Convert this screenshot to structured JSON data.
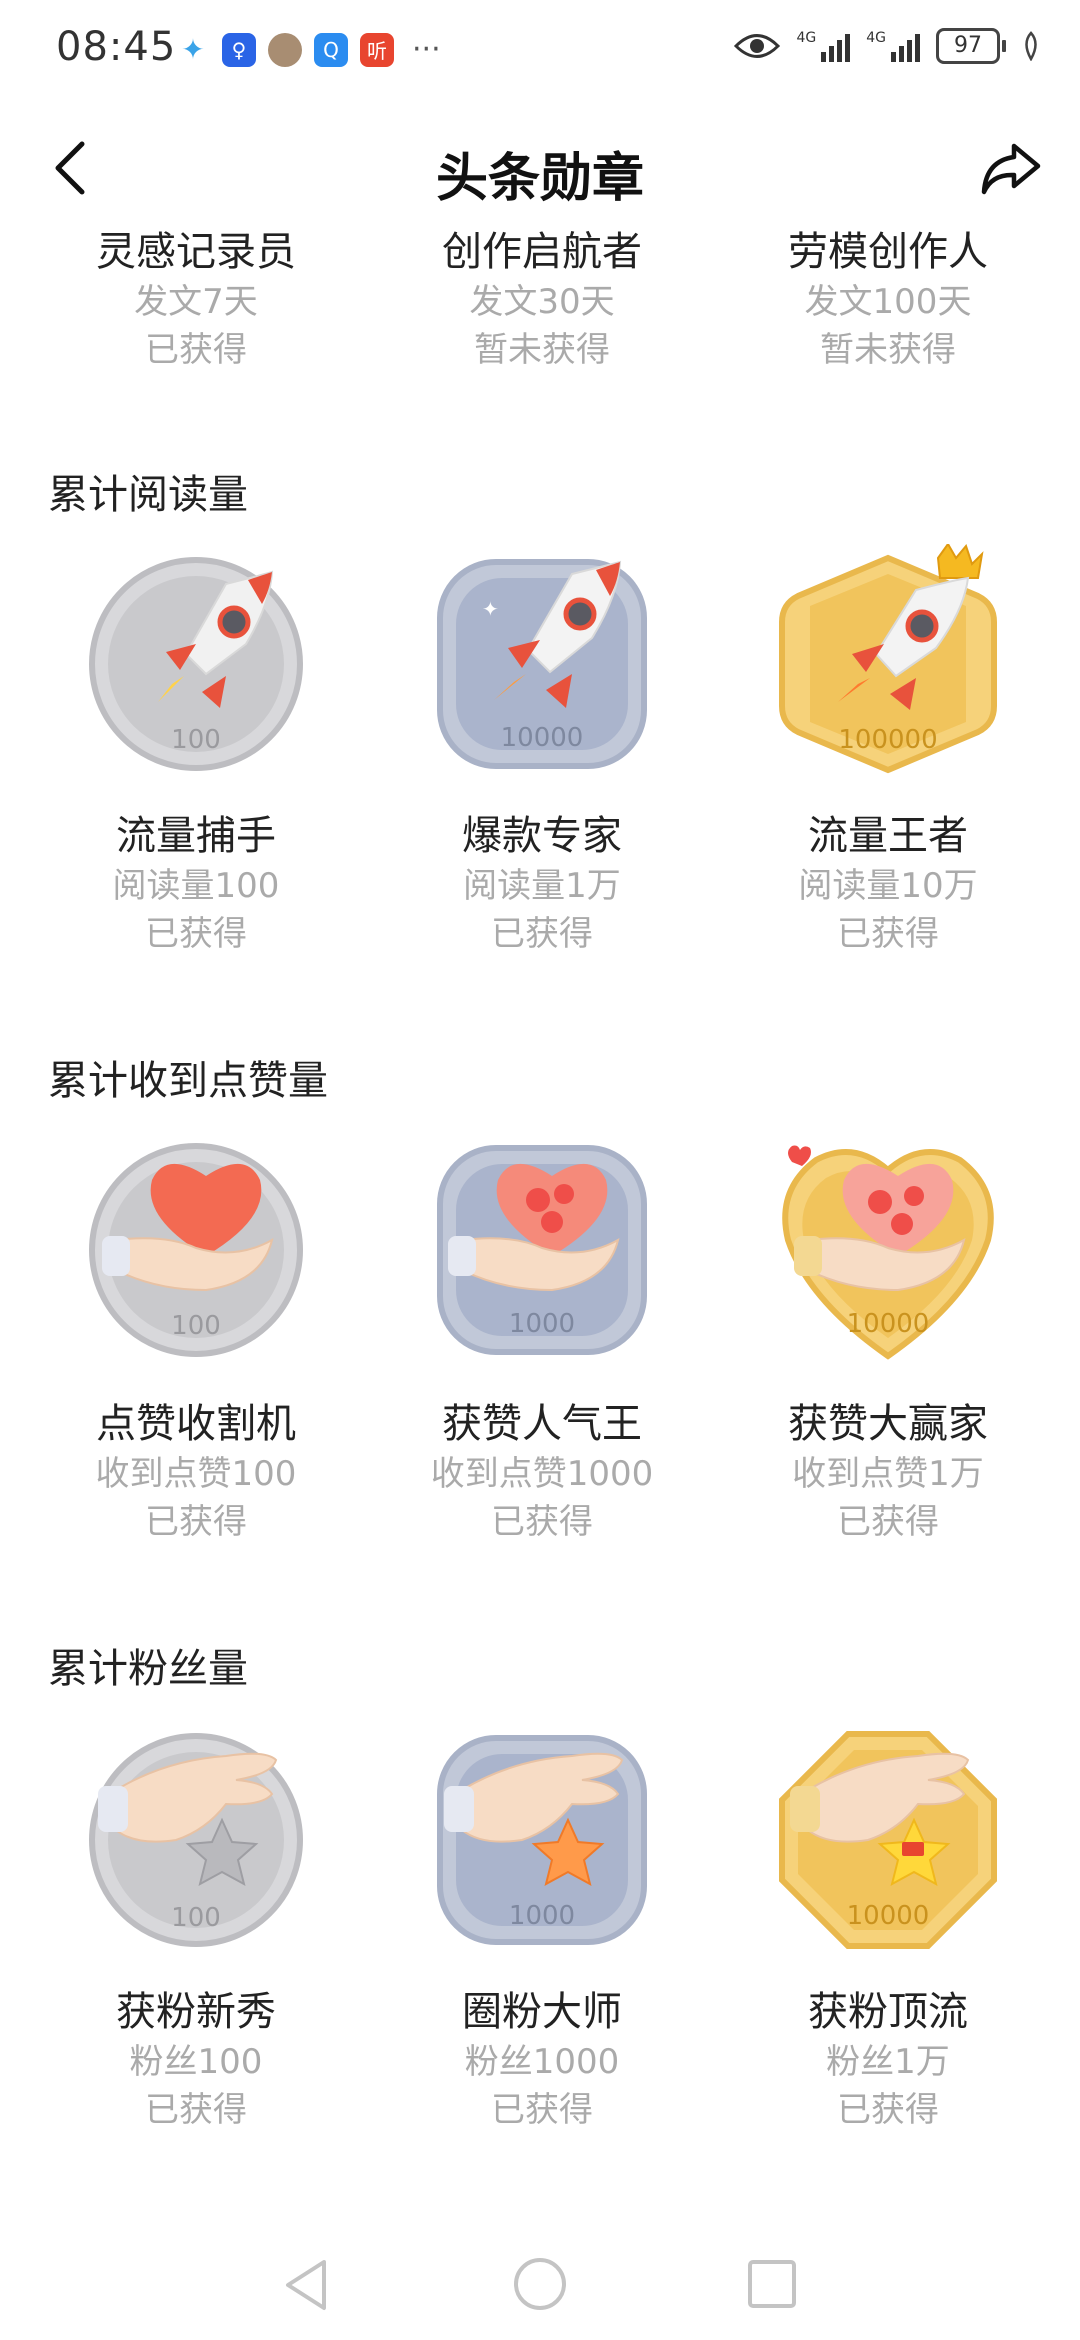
{
  "status_bar": {
    "time": "08:45",
    "notification_icons": [
      "compass-icon",
      "bulb-icon",
      "avatar-icon",
      "search-app-icon",
      "listen-app-icon"
    ],
    "notification_label": "听",
    "signal_label_1": "4G",
    "signal_label_2": "4G",
    "battery": "97"
  },
  "header": {
    "title": "头条勋章"
  },
  "partial_row": [
    {
      "name": "灵感记录员",
      "req": "发文7天",
      "status": "已获得"
    },
    {
      "name": "创作启航者",
      "req": "发文30天",
      "status": "暂未获得"
    },
    {
      "name": "劳模创作人",
      "req": "发文100天",
      "status": "暂未获得"
    }
  ],
  "sections": [
    {
      "title": "累计阅读量",
      "badges": [
        {
          "name": "流量捕手",
          "req": "阅读量100",
          "status": "已获得",
          "icon_number": "100",
          "tier": "silver",
          "icon": "rocket-icon"
        },
        {
          "name": "爆款专家",
          "req": "阅读量1万",
          "status": "已获得",
          "icon_number": "10000",
          "tier": "blue",
          "icon": "rocket-icon"
        },
        {
          "name": "流量王者",
          "req": "阅读量10万",
          "status": "已获得",
          "icon_number": "100000",
          "tier": "gold",
          "icon": "crowned-rocket-icon"
        }
      ]
    },
    {
      "title": "累计收到点赞量",
      "badges": [
        {
          "name": "点赞收割机",
          "req": "收到点赞100",
          "status": "已获得",
          "icon_number": "100",
          "tier": "silver",
          "icon": "heart-in-hand-icon"
        },
        {
          "name": "获赞人气王",
          "req": "收到点赞1000",
          "status": "已获得",
          "icon_number": "1000",
          "tier": "blue",
          "icon": "heart-in-hand-icon"
        },
        {
          "name": "获赞大赢家",
          "req": "收到点赞1万",
          "status": "已获得",
          "icon_number": "10000",
          "tier": "gold",
          "icon": "heart-in-hand-icon"
        }
      ]
    },
    {
      "title": "累计粉丝量",
      "badges": [
        {
          "name": "获粉新秀",
          "req": "粉丝100",
          "status": "已获得",
          "icon_number": "100",
          "tier": "silver",
          "icon": "star-hand-icon"
        },
        {
          "name": "圈粉大师",
          "req": "粉丝1000",
          "status": "已获得",
          "icon_number": "1000",
          "tier": "blue",
          "icon": "star-hand-icon"
        },
        {
          "name": "获粉顶流",
          "req": "粉丝1万",
          "status": "已获得",
          "icon_number": "10000",
          "tier": "gold",
          "icon": "star-hand-icon"
        }
      ]
    }
  ],
  "colors": {
    "silver": "#c9c9cc",
    "blue": "#aab4cc",
    "gold": "#f1c45c",
    "muted_text": "#aaaaaa"
  },
  "system_nav": [
    "back-triangle-icon",
    "home-circle-icon",
    "recents-square-icon"
  ]
}
